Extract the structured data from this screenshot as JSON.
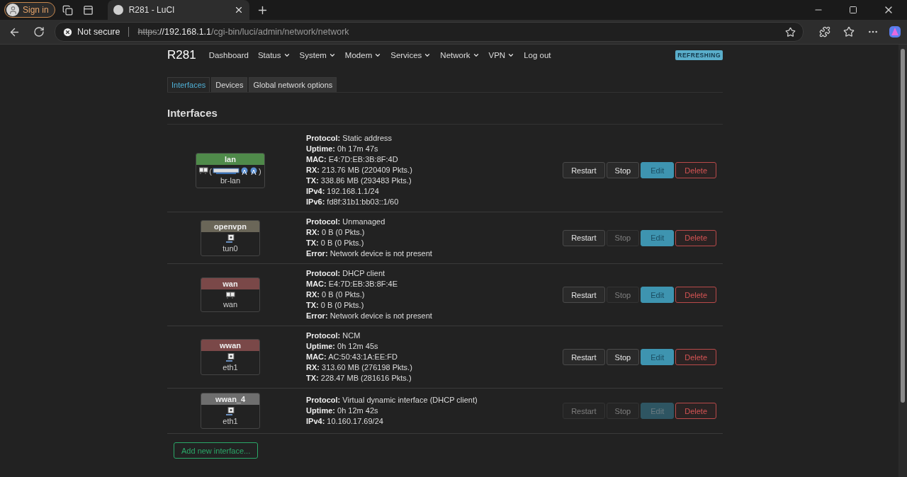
{
  "browser": {
    "sign_in": "Sign in",
    "tab": {
      "title": "R281 - LuCI"
    },
    "security": "Not secure",
    "url": {
      "scheme": "https",
      "host": "://192.168.1.1",
      "path": "/cgi-bin/luci/admin/network/network"
    }
  },
  "nav": {
    "brand": "R281",
    "items": [
      {
        "label": "Dashboard",
        "menu": false
      },
      {
        "label": "Status",
        "menu": true
      },
      {
        "label": "System",
        "menu": true
      },
      {
        "label": "Modem",
        "menu": true
      },
      {
        "label": "Services",
        "menu": true
      },
      {
        "label": "Network",
        "menu": true
      },
      {
        "label": "VPN",
        "menu": true
      },
      {
        "label": "Log out",
        "menu": false
      }
    ],
    "badge": "REFRESHING"
  },
  "tabs": [
    {
      "label": "Interfaces",
      "selected": true
    },
    {
      "label": "Devices",
      "selected": false
    },
    {
      "label": "Global network options",
      "selected": false
    }
  ],
  "heading": "Interfaces",
  "interfaces": [
    {
      "name": "lan",
      "color": "#4f8a4a",
      "device": "br-lan",
      "icon": {
        "kind": "bridge",
        "open": "(",
        "close": ")",
        "members": [
          {
            "kind": "switch"
          },
          {
            "kind": "wifi"
          },
          {
            "kind": "wifi"
          }
        ]
      },
      "info": [
        {
          "label": "Protocol:",
          "value": "Static address"
        },
        {
          "label": "Uptime:",
          "value": "0h 17m 47s"
        },
        {
          "label": "MAC:",
          "value": "E4:7D:EB:3B:8F:4D"
        },
        {
          "label": "RX:",
          "value": "213.76 MB (220409 Pkts.)"
        },
        {
          "label": "TX:",
          "value": "338.86 MB (293483 Pkts.)"
        },
        {
          "label": "IPv4:",
          "value": "192.168.1.1/24"
        },
        {
          "label": "IPv6:",
          "value": "fd8f:31b1:bb03::1/60"
        }
      ],
      "buttons": [
        {
          "label": "Restart",
          "kind": "plain",
          "disabled": false
        },
        {
          "label": "Stop",
          "kind": "plain",
          "disabled": false
        },
        {
          "label": "Edit",
          "kind": "edit",
          "disabled": false
        },
        {
          "label": "Delete",
          "kind": "delete",
          "disabled": false
        }
      ]
    },
    {
      "name": "openvpn",
      "color": "#6a6658",
      "device": "tun0",
      "icon": {
        "kind": "tunnel"
      },
      "info": [
        {
          "label": "Protocol:",
          "value": "Unmanaged"
        },
        {
          "label": "RX:",
          "value": "0 B (0 Pkts.)"
        },
        {
          "label": "TX:",
          "value": "0 B (0 Pkts.)"
        },
        {
          "label": "Error:",
          "value": "Network device is not present"
        }
      ],
      "buttons": [
        {
          "label": "Restart",
          "kind": "plain",
          "disabled": false
        },
        {
          "label": "Stop",
          "kind": "plain",
          "disabled": true
        },
        {
          "label": "Edit",
          "kind": "edit",
          "disabled": false
        },
        {
          "label": "Delete",
          "kind": "delete",
          "disabled": false
        }
      ]
    },
    {
      "name": "wan",
      "color": "#7a4848",
      "device": "wan",
      "icon": {
        "kind": "ethernet"
      },
      "info": [
        {
          "label": "Protocol:",
          "value": "DHCP client"
        },
        {
          "label": "MAC:",
          "value": "E4:7D:EB:3B:8F:4E"
        },
        {
          "label": "RX:",
          "value": "0 B (0 Pkts.)"
        },
        {
          "label": "TX:",
          "value": "0 B (0 Pkts.)"
        },
        {
          "label": "Error:",
          "value": "Network device is not present"
        }
      ],
      "buttons": [
        {
          "label": "Restart",
          "kind": "plain",
          "disabled": false
        },
        {
          "label": "Stop",
          "kind": "plain",
          "disabled": true
        },
        {
          "label": "Edit",
          "kind": "edit",
          "disabled": false
        },
        {
          "label": "Delete",
          "kind": "delete",
          "disabled": false
        }
      ]
    },
    {
      "name": "wwan",
      "color": "#7a4848",
      "device": "eth1",
      "icon": {
        "kind": "tunnel"
      },
      "info": [
        {
          "label": "Protocol:",
          "value": "NCM"
        },
        {
          "label": "Uptime:",
          "value": "0h 12m 45s"
        },
        {
          "label": "MAC:",
          "value": "AC:50:43:1A:EE:FD"
        },
        {
          "label": "RX:",
          "value": "313.60 MB (276198 Pkts.)"
        },
        {
          "label": "TX:",
          "value": "228.47 MB (281616 Pkts.)"
        }
      ],
      "buttons": [
        {
          "label": "Restart",
          "kind": "plain",
          "disabled": false
        },
        {
          "label": "Stop",
          "kind": "plain",
          "disabled": false
        },
        {
          "label": "Edit",
          "kind": "edit",
          "disabled": false
        },
        {
          "label": "Delete",
          "kind": "delete",
          "disabled": false
        }
      ]
    },
    {
      "name": "wwan_4",
      "color": "#6e6e6e",
      "device": "eth1",
      "icon": {
        "kind": "tunnel"
      },
      "info": [
        {
          "label": "Protocol:",
          "value": "Virtual dynamic interface (DHCP client)"
        },
        {
          "label": "Uptime:",
          "value": "0h 12m 42s"
        },
        {
          "label": "IPv4:",
          "value": "10.160.17.69/24"
        }
      ],
      "buttons": [
        {
          "label": "Restart",
          "kind": "plain",
          "disabled": true
        },
        {
          "label": "Stop",
          "kind": "plain",
          "disabled": true
        },
        {
          "label": "Edit",
          "kind": "edit",
          "disabled": true
        },
        {
          "label": "Delete",
          "kind": "delete",
          "disabled": false
        }
      ]
    }
  ],
  "add_button": "Add new interface..."
}
